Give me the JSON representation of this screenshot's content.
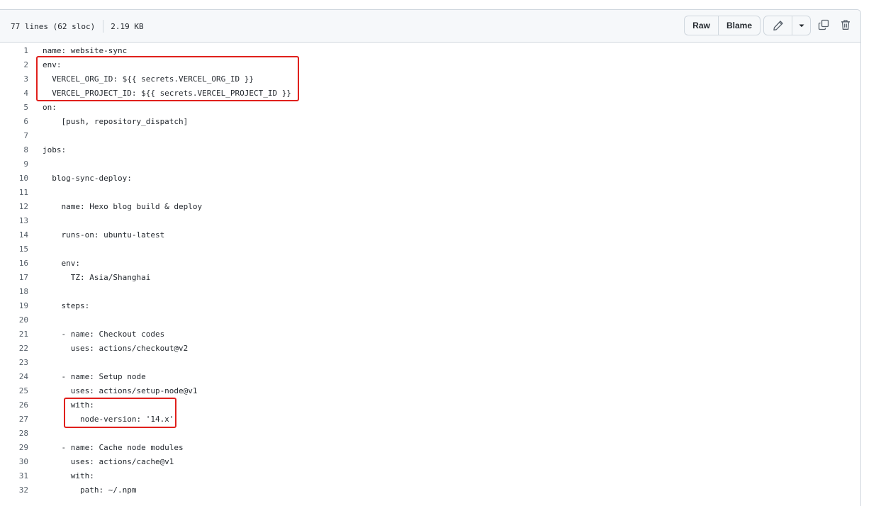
{
  "file_header": {
    "lines_info": "77 lines (62 sloc)",
    "size": "2.19 KB",
    "raw_label": "Raw",
    "blame_label": "Blame",
    "edit_icon": "pencil-icon",
    "dropdown_icon": "triangle-down-icon",
    "copy_icon": "copy-icon",
    "delete_icon": "trash-icon"
  },
  "code_lines": [
    {
      "num": "1",
      "text": "name: website-sync"
    },
    {
      "num": "2",
      "text": "env:"
    },
    {
      "num": "3",
      "text": "  VERCEL_ORG_ID: ${{ secrets.VERCEL_ORG_ID }}"
    },
    {
      "num": "4",
      "text": "  VERCEL_PROJECT_ID: ${{ secrets.VERCEL_PROJECT_ID }}"
    },
    {
      "num": "5",
      "text": "on:"
    },
    {
      "num": "6",
      "text": "    [push, repository_dispatch]"
    },
    {
      "num": "7",
      "text": ""
    },
    {
      "num": "8",
      "text": "jobs:"
    },
    {
      "num": "9",
      "text": ""
    },
    {
      "num": "10",
      "text": "  blog-sync-deploy:"
    },
    {
      "num": "11",
      "text": ""
    },
    {
      "num": "12",
      "text": "    name: Hexo blog build & deploy"
    },
    {
      "num": "13",
      "text": ""
    },
    {
      "num": "14",
      "text": "    runs-on: ubuntu-latest"
    },
    {
      "num": "15",
      "text": ""
    },
    {
      "num": "16",
      "text": "    env:"
    },
    {
      "num": "17",
      "text": "      TZ: Asia/Shanghai"
    },
    {
      "num": "18",
      "text": ""
    },
    {
      "num": "19",
      "text": "    steps:"
    },
    {
      "num": "20",
      "text": ""
    },
    {
      "num": "21",
      "text": "    - name: Checkout codes"
    },
    {
      "num": "22",
      "text": "      uses: actions/checkout@v2"
    },
    {
      "num": "23",
      "text": ""
    },
    {
      "num": "24",
      "text": "    - name: Setup node"
    },
    {
      "num": "25",
      "text": "      uses: actions/setup-node@v1"
    },
    {
      "num": "26",
      "text": "      with:"
    },
    {
      "num": "27",
      "text": "        node-version: '14.x'"
    },
    {
      "num": "28",
      "text": ""
    },
    {
      "num": "29",
      "text": "    - name: Cache node modules"
    },
    {
      "num": "30",
      "text": "      uses: actions/cache@v1"
    },
    {
      "num": "31",
      "text": "      with:"
    },
    {
      "num": "32",
      "text": "        path: ~/.npm"
    }
  ],
  "colors": {
    "highlight_border": "#e0201c",
    "header_bg": "#f6f8fa",
    "border": "#d0d7de",
    "line_number": "#57606a",
    "text": "#24292f"
  }
}
